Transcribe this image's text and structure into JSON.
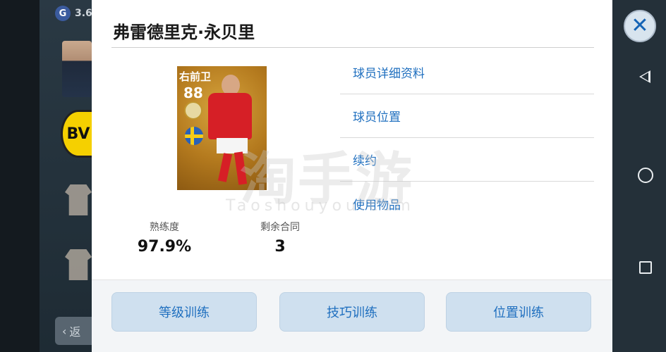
{
  "status": {
    "badge_icon": "G",
    "value": "3.6"
  },
  "background": {
    "back_label": "返",
    "club_icon": "BV"
  },
  "dialog": {
    "title": "弗雷德里克·永贝里",
    "card": {
      "position": "右前卫",
      "rating": "88"
    },
    "stats": [
      {
        "label": "熟练度",
        "value": "97.9%"
      },
      {
        "label": "剩余合同",
        "value": "3"
      }
    ],
    "menu": [
      "球员详细资料",
      "球员位置",
      "续约",
      "使用物品"
    ],
    "buttons": [
      "等级训练",
      "技巧训练",
      "位置训练"
    ],
    "watermark": {
      "main": "淘手游",
      "sub": "Taoshouyou.com"
    }
  },
  "colors": {
    "accent": "#1f6fbf",
    "button_bg": "#cfe0ef",
    "card_gold": "#b47a1e"
  },
  "icons": {
    "close": "close-icon",
    "nav_back": "back-triangle-icon",
    "nav_home": "home-circle-icon",
    "nav_recent": "recent-square-icon"
  }
}
